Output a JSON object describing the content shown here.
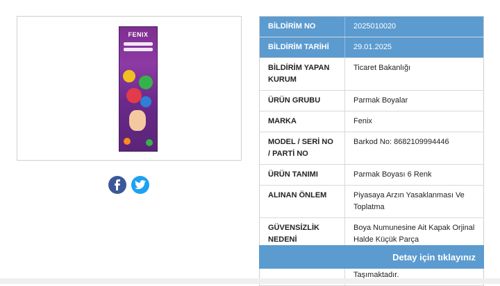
{
  "product_image": {
    "brand": "FENIX"
  },
  "social": {
    "facebook_icon": "facebook-icon",
    "twitter_icon": "twitter-icon"
  },
  "info": {
    "rows": [
      {
        "key": "BİLDİRİM NO",
        "value": "2025010020",
        "highlight": true
      },
      {
        "key": "BİLDİRİM TARİHİ",
        "value": "29.01.2025",
        "highlight": true
      },
      {
        "key": "BİLDİRİM YAPAN KURUM",
        "value": "Ticaret Bakanlığı"
      },
      {
        "key": "ÜRÜN GRUBU",
        "value": "Parmak Boyalar"
      },
      {
        "key": "MARKA",
        "value": "Fenix"
      },
      {
        "key": "MODEL / SERİ NO / PARTİ NO",
        "value": "Barkod No: 8682109994446"
      },
      {
        "key": "ÜRÜN TANIMI",
        "value": "Parmak Boyası 6 Renk"
      },
      {
        "key": "ALINAN ÖNLEM",
        "value": "Piyasaya Arzın Yasaklanması Ve Toplatma"
      },
      {
        "key": "GÜVENSİZLİK NEDENİ",
        "value": "Boya Numunesine Ait Kapak Orjinal Halde Küçük Parça Oluşturduğundan 3 Yaşından Küçük Çocuklar İçin Boğulma Riski Taşımaktadır."
      }
    ]
  },
  "detail_button": {
    "label": "Detay için tıklayınız"
  },
  "colors": {
    "highlight": "#5b9bd0",
    "facebook": "#3b5998",
    "twitter": "#1da1f2"
  }
}
